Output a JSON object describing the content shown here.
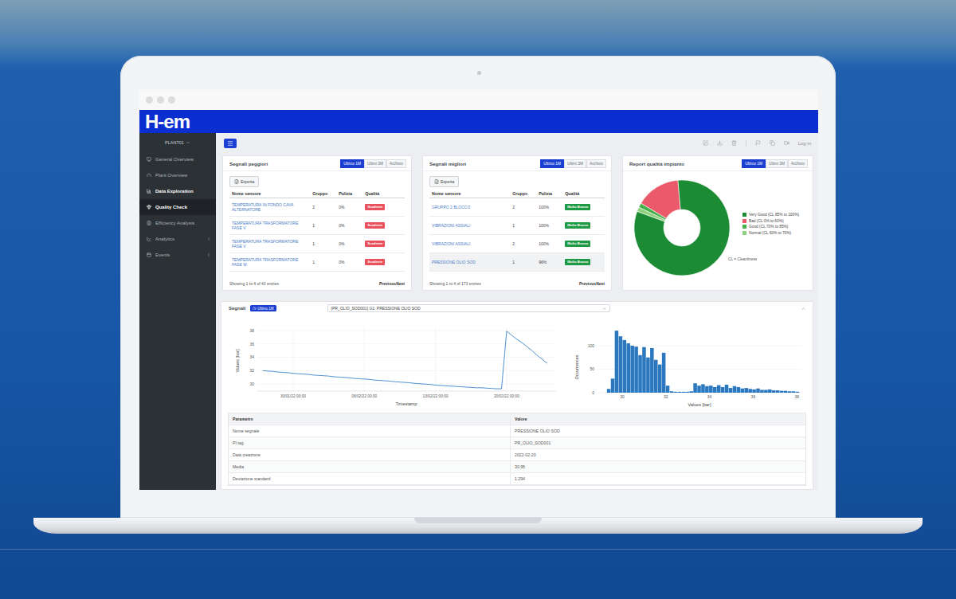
{
  "header": {
    "logo": "H-em",
    "plant": "PLANT01",
    "login": "Log in"
  },
  "sidebar": {
    "items": [
      {
        "label": "General Overview",
        "selected": false,
        "bold": false,
        "expandable": false
      },
      {
        "label": "Plant Overview",
        "selected": false,
        "bold": false,
        "expandable": false
      },
      {
        "label": "Data Exploration",
        "selected": false,
        "bold": true,
        "expandable": false
      },
      {
        "label": "Quality Check",
        "selected": true,
        "bold": true,
        "expandable": false
      },
      {
        "label": "Efficiency Analysis",
        "selected": false,
        "bold": false,
        "expandable": false
      },
      {
        "label": "Analytics",
        "selected": false,
        "bold": false,
        "expandable": true
      },
      {
        "label": "Events",
        "selected": false,
        "bold": false,
        "expandable": true
      }
    ]
  },
  "signal_cards": [
    {
      "title": "Segnali peggiori",
      "tabs": [
        {
          "label": "Ultimo 1M",
          "selected": true
        },
        {
          "label": "Ultimi 3M",
          "selected": false
        },
        {
          "label": "Archivio",
          "selected": false
        }
      ],
      "export": "Esporta",
      "columns": [
        "Nome sensore",
        "Gruppo",
        "Pulizia",
        "Qualità"
      ],
      "rows": [
        {
          "name": "TEMPERATURA IN FONDO CAVA ALTERNATORE",
          "group": "2",
          "cleanliness": "0%",
          "quality": "Scadente",
          "color": "#e8505b",
          "highlighted": false
        },
        {
          "name": "TEMPERATURA TRASFORMATORE FASE V",
          "group": "1",
          "cleanliness": "0%",
          "quality": "Scadente",
          "color": "#e8505b",
          "highlighted": false
        },
        {
          "name": "TEMPERATURA TRASFORMATORE FASE V",
          "group": "1",
          "cleanliness": "0%",
          "quality": "Scadente",
          "color": "#e8505b",
          "highlighted": false
        },
        {
          "name": "TEMPERATURA TRASFORMATORE FASE W",
          "group": "1",
          "cleanliness": "0%",
          "quality": "Scadente",
          "color": "#e8505b",
          "highlighted": false
        }
      ],
      "footer": "Showing 1 to 4 of 43 entries",
      "pager": [
        "Previous",
        "Next"
      ]
    },
    {
      "title": "Segnali migliori",
      "tabs": [
        {
          "label": "Ultimo 1M",
          "selected": true
        },
        {
          "label": "Ultimi 3M",
          "selected": false
        },
        {
          "label": "Archivio",
          "selected": false
        }
      ],
      "export": "Esporta",
      "columns": [
        "Nome sensore",
        "Gruppo",
        "Pulizia",
        "Qualità"
      ],
      "rows": [
        {
          "name": "GRUPPO 2 BLOCCO",
          "group": "2",
          "cleanliness": "100%",
          "quality": "Molto Buono",
          "color": "#1e9a45",
          "highlighted": false
        },
        {
          "name": "VIBRAZIONI ASSIALI",
          "group": "1",
          "cleanliness": "100%",
          "quality": "Molto Buono",
          "color": "#1e9a45",
          "highlighted": false
        },
        {
          "name": "VIBRAZIONI ASSIALI",
          "group": "2",
          "cleanliness": "100%",
          "quality": "Molto Buono",
          "color": "#1e9a45",
          "highlighted": false
        },
        {
          "name": "PRESSIONE OLIO SOD",
          "group": "1",
          "cleanliness": "96%",
          "quality": "Molto Buono",
          "color": "#1e9a45",
          "highlighted": true
        }
      ],
      "footer": "Showing 1 to 4 of 173 entries",
      "pager": [
        "Previous",
        "Next"
      ]
    }
  ],
  "quality_report": {
    "title": "Report qualità impianto",
    "tabs": [
      {
        "label": "Ultimo 1M",
        "selected": true
      },
      {
        "label": "Ultimi 3M",
        "selected": false
      },
      {
        "label": "Archivio",
        "selected": false
      }
    ],
    "slices": [
      {
        "label": "Very Good (CL 85% to 100%)",
        "share": 0.82,
        "color": "#1c8c34"
      },
      {
        "label": "Bad (CL 0% to 60%)",
        "share": 0.15,
        "color": "#ea5a6a"
      },
      {
        "label": "Good (CL 70% to 85%)",
        "share": 0.015,
        "color": "#46b04a"
      },
      {
        "label": "Normal (CL 60% to 70%)",
        "share": 0.015,
        "color": "#8fd17e"
      }
    ],
    "note": "CL = Cleanliness"
  },
  "signals": {
    "title": "Segnali",
    "badge": "Ultimo 1M",
    "selector": "[PR_OLIO_SOD001] G1: PRESSIONE OLIO SOD",
    "line_chart": {
      "y_label": "Values [bar]",
      "x_label": "Timestamp",
      "y_ticks": [
        "38",
        "36",
        "34",
        "32",
        "30"
      ],
      "x_ticks": [
        "30/01/22 00:00",
        "06/02/22 00:00",
        "13/02/22 00:00",
        "20/02/22 00:00"
      ],
      "values": [
        32.0,
        31.95,
        31.9,
        31.8,
        31.75,
        31.7,
        31.6,
        31.55,
        31.5,
        31.45,
        31.35,
        31.3,
        31.25,
        31.2,
        31.1,
        31.05,
        31.0,
        30.95,
        30.85,
        30.8,
        30.75,
        30.7,
        30.6,
        30.55,
        30.5,
        30.45,
        30.35,
        30.3,
        30.25,
        30.2,
        30.1,
        30.05,
        30.0,
        29.95,
        29.85,
        29.8,
        29.75,
        29.7,
        29.65,
        29.6,
        29.55,
        29.5,
        29.45,
        29.45,
        29.4,
        29.35,
        29.3,
        29.3,
        37.9,
        37.3,
        36.7,
        36.2,
        35.6,
        35.0,
        34.3,
        33.7,
        33.1
      ]
    },
    "histogram": {
      "y_label": "Occurrences",
      "x_label": "Values [bar]",
      "y_ticks": [
        "100",
        "50",
        "0"
      ],
      "x_ticks": [
        "30",
        "32",
        "34",
        "36",
        "38"
      ],
      "bin_start": 29.3,
      "bin_width": 0.18,
      "counts": [
        8,
        30,
        132,
        120,
        112,
        105,
        100,
        98,
        80,
        97,
        75,
        95,
        70,
        60,
        85,
        15,
        3,
        2,
        2,
        2,
        2,
        3,
        20,
        15,
        18,
        14,
        15,
        12,
        16,
        12,
        17,
        10,
        14,
        12,
        9,
        10,
        8,
        7,
        9,
        6,
        6,
        7,
        5,
        5,
        4,
        4,
        3,
        3,
        2
      ]
    },
    "table": {
      "columns": [
        "Parametro",
        "Valore"
      ],
      "rows": [
        [
          "Nome segnale",
          "PRESSIONE OLIO SOD"
        ],
        [
          "PI tag",
          "PR_OLIO_SOD001"
        ],
        [
          "Data creazione",
          "2022-02-20"
        ],
        [
          "Media",
          "30.95"
        ],
        [
          "Deviazione standard",
          "1.294"
        ]
      ]
    }
  }
}
